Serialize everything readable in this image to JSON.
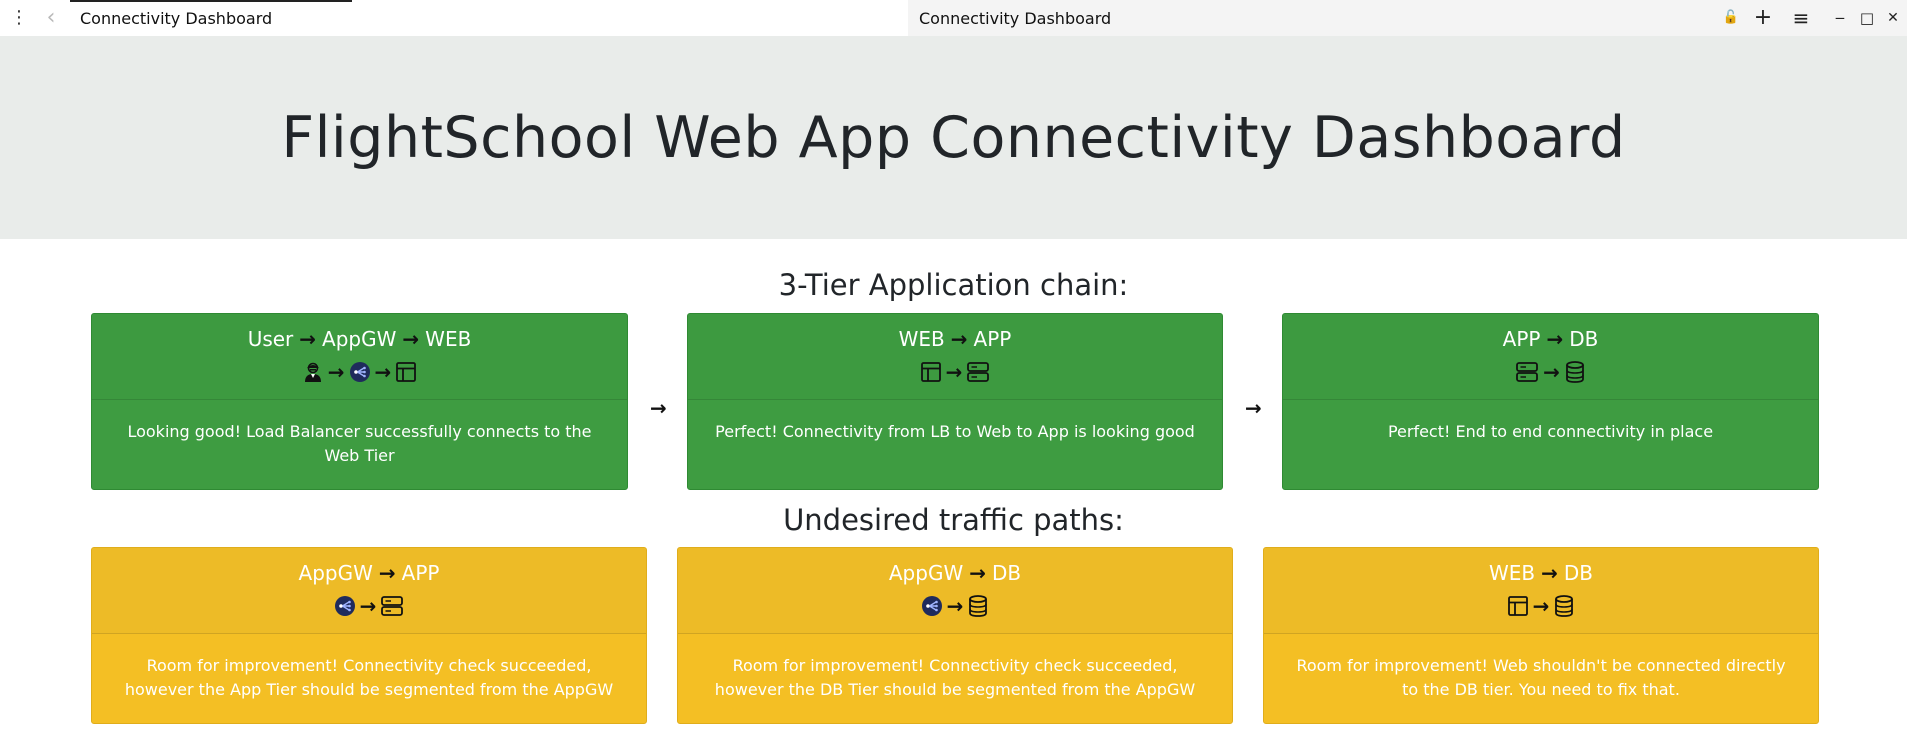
{
  "browser": {
    "tab_left_title": "Connectivity Dashboard",
    "tab_right_title": "Connectivity Dashboard",
    "menu_glyph": "⋮",
    "back_glyph": "‹",
    "controls": {
      "lock_glyph": "🔓",
      "new_tab_glyph": "+",
      "menu_glyph": "≡",
      "minimize_glyph": "‒",
      "maximize_glyph": "□",
      "close_glyph": "✕"
    }
  },
  "page": {
    "title": "FlightSchool Web App Connectivity Dashboard",
    "desired_section_title": "3-Tier Application chain:",
    "undesired_section_title": "Undesired traffic paths:",
    "chain_arrow": "→"
  },
  "desired_cards": [
    {
      "path_parts": [
        "User",
        "AppGW",
        "WEB"
      ],
      "icons": [
        "user-icon",
        "appgw-icon",
        "web-icon"
      ],
      "status": "success",
      "message": "Looking good! Load Balancer successfully connects to the Web Tier"
    },
    {
      "path_parts": [
        "WEB",
        "APP"
      ],
      "icons": [
        "web-icon",
        "server-icon"
      ],
      "status": "success",
      "message": "Perfect! Connectivity from LB to Web to App is looking good"
    },
    {
      "path_parts": [
        "APP",
        "DB"
      ],
      "icons": [
        "server-icon",
        "database-icon"
      ],
      "status": "success",
      "message": "Perfect! End to end connectivity in place"
    }
  ],
  "undesired_cards": [
    {
      "path_parts": [
        "AppGW",
        "APP"
      ],
      "icons": [
        "appgw-icon",
        "server-icon"
      ],
      "status": "warning",
      "message": "Room for improvement! Connectivity check succeeded, however the App Tier should be segmented from the AppGW"
    },
    {
      "path_parts": [
        "AppGW",
        "DB"
      ],
      "icons": [
        "appgw-icon",
        "database-icon"
      ],
      "status": "warning",
      "message": "Room for improvement! Connectivity check succeeded, however the DB Tier should be segmented from the AppGW"
    },
    {
      "path_parts": [
        "WEB",
        "DB"
      ],
      "icons": [
        "web-icon",
        "database-icon"
      ],
      "status": "warning",
      "message": "Room for improvement! Web shouldn't be connected directly to the DB tier. You need to fix that."
    }
  ],
  "colors": {
    "success": "#3e9c41",
    "warning": "#f4bf24",
    "jumbotron": "#e9ecea"
  }
}
